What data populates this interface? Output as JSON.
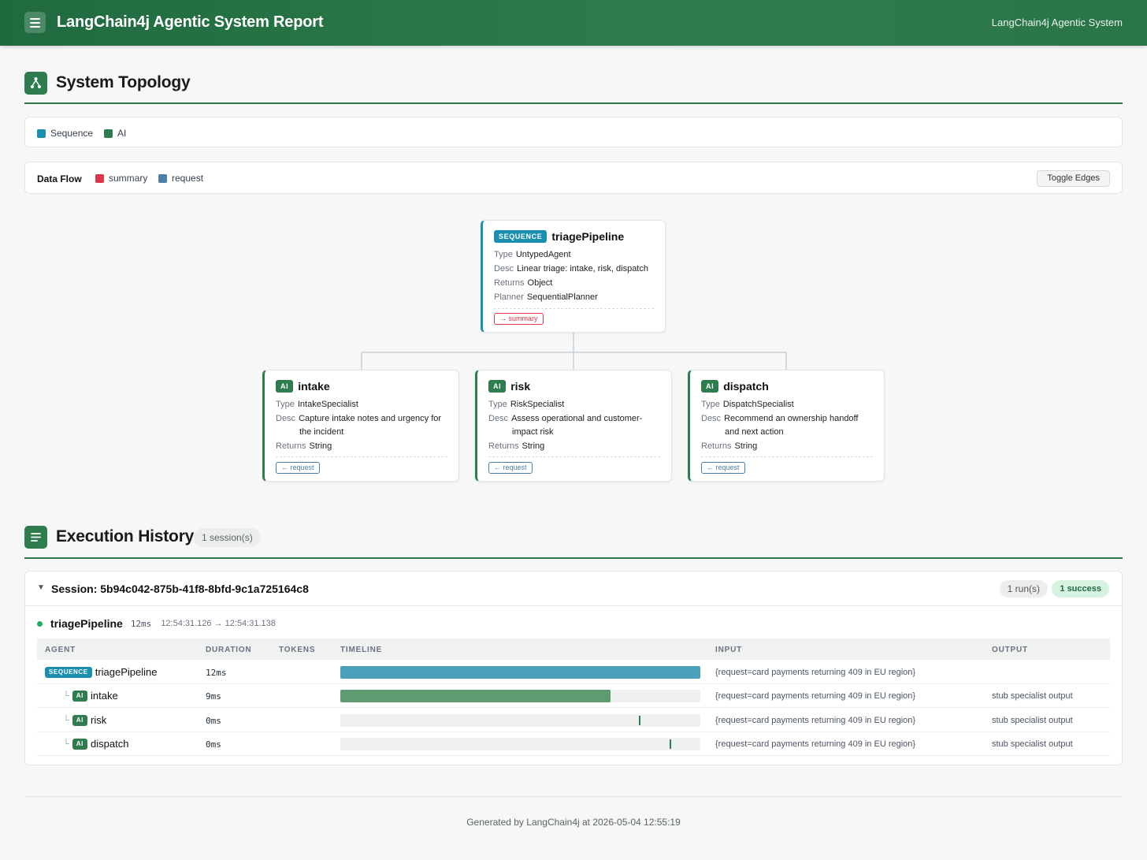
{
  "header": {
    "title": "LangChain4j Agentic System Report",
    "right_label": "LangChain4j Agentic System"
  },
  "topology": {
    "title": "System Topology",
    "legend": [
      {
        "label": "Sequence",
        "color": "#1a8fb0"
      },
      {
        "label": "AI",
        "color": "#2f7d4e"
      }
    ],
    "data_flow": {
      "label": "Data Flow",
      "items": [
        {
          "label": "summary",
          "color": "#dc3545"
        },
        {
          "label": "request",
          "color": "#4c7fa6"
        }
      ],
      "toggle_label": "Toggle Edges"
    },
    "root": {
      "badge": "SEQUENCE",
      "name": "triagePipeline",
      "props": [
        {
          "k": "Type",
          "v": "UntypedAgent"
        },
        {
          "k": "Desc",
          "v": "Linear triage: intake, risk, dispatch"
        },
        {
          "k": "Returns",
          "v": "Object"
        },
        {
          "k": "Planner",
          "v": "SequentialPlanner"
        }
      ],
      "chip": "→ summary"
    },
    "children": [
      {
        "badge": "AI",
        "name": "intake",
        "type": "IntakeSpecialist",
        "desc1": "Capture intake notes and urgency for",
        "desc2": "the incident",
        "returns": "String",
        "chip": "← request"
      },
      {
        "badge": "AI",
        "name": "risk",
        "type": "RiskSpecialist",
        "desc1": "Assess operational and customer-",
        "desc2": "impact risk",
        "returns": "String",
        "chip": "← request"
      },
      {
        "badge": "AI",
        "name": "dispatch",
        "type": "DispatchSpecialist",
        "desc1": "Recommend an ownership handoff",
        "desc2": "and next action",
        "returns": "String",
        "chip": "← request"
      }
    ],
    "prop_labels": {
      "type": "Type",
      "desc": "Desc",
      "returns": "Returns"
    }
  },
  "history": {
    "title": "Execution History",
    "sessions_pill": "1 session(s)",
    "session": {
      "toggle": "▼",
      "id": "Session: 5b94c042-875b-41f8-8bfd-9c1a725164c8",
      "runs": "1 run(s)",
      "success": "1 success",
      "run": {
        "name": "triagePipeline",
        "duration": "12ms",
        "time": "12:54:31.126 → 12:54:31.138"
      },
      "columns": [
        "AGENT",
        "DURATION",
        "TOKENS",
        "TIMELINE",
        "INPUT",
        "OUTPUT"
      ],
      "rows": [
        {
          "tree": "",
          "badge": "SEQUENCE",
          "agent": "triagePipeline",
          "duration": "12ms",
          "tokens": "",
          "timeline_start": 0.0,
          "timeline_fraction": 1.0,
          "input": "{request=card payments returning 409 in EU region}",
          "output": ""
        },
        {
          "tree": "└",
          "badge": "AI",
          "agent": "intake",
          "duration": "9ms",
          "tokens": "",
          "timeline_start": 0.0,
          "timeline_fraction": 0.75,
          "input": "{request=card payments returning 409 in EU region}",
          "output": "stub specialist output"
        },
        {
          "tree": "└",
          "badge": "AI",
          "agent": "risk",
          "duration": "0ms",
          "tokens": "",
          "timeline_start": 0.83,
          "timeline_fraction": 0.0,
          "input": "{request=card payments returning 409 in EU region}",
          "output": "stub specialist output"
        },
        {
          "tree": "└",
          "badge": "AI",
          "agent": "dispatch",
          "duration": "0ms",
          "tokens": "",
          "timeline_start": 0.915,
          "timeline_fraction": 0.0,
          "input": "{request=card payments returning 409 in EU region}",
          "output": "stub specialist output"
        }
      ]
    }
  },
  "footer": "Generated by LangChain4j at 2026-05-04 12:55:19"
}
